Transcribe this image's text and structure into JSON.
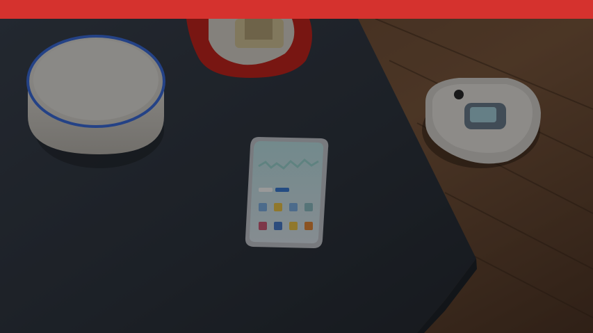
{
  "header": {
    "bar_color": "#d5322e"
  },
  "hero": {
    "image_alt": "",
    "overlay_color": "#000000",
    "overlay_opacity": 0.4
  },
  "phone_screen": {
    "line_color": "#9fd9d6",
    "icon_colors": [
      "#7fb3e8",
      "#f0c84a",
      "#7fb3e8",
      "#8fc1c9",
      "#d05c7a",
      "#4a7fd0",
      "#f0c84a",
      "#e88a3a"
    ]
  }
}
